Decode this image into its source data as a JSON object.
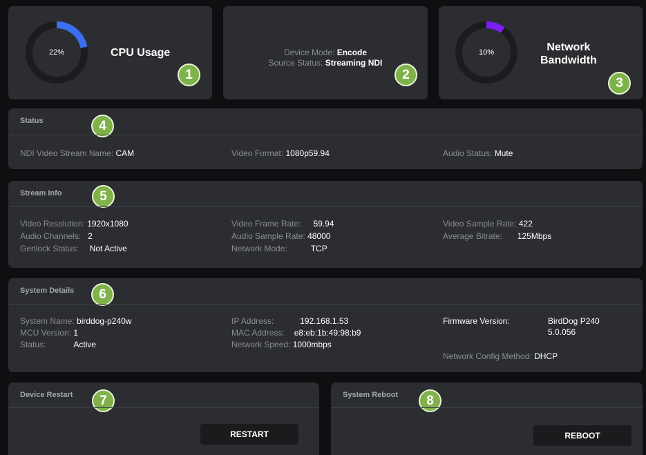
{
  "cpu": {
    "percent_text": "22%",
    "fraction": 0.22,
    "label": "CPU Usage",
    "color": "#3a6ff0"
  },
  "device": {
    "mode_label": "Device Mode:",
    "mode_value": "Encode",
    "source_label": "Source Status:",
    "source_value": "Streaming NDI"
  },
  "network": {
    "percent_text": "10%",
    "fraction": 0.1,
    "label_line1": "Network",
    "label_line2": "Bandwidth",
    "color": "#7a1ff0"
  },
  "badges": [
    "1",
    "2",
    "3",
    "4",
    "5",
    "6",
    "7",
    "8"
  ],
  "status": {
    "title": "Status",
    "ndi_label": "NDI Video Stream Name:",
    "ndi_value": "CAM",
    "format_label": "Video Format:",
    "format_value": "1080p59.94",
    "audio_label": "Audio Status:",
    "audio_value": "Mute"
  },
  "stream_info": {
    "title": "Stream Info",
    "resolution_label": "Video Resolution:",
    "resolution_value": "1920x1080",
    "channels_label": "Audio Channels:",
    "channels_value": "2",
    "genlock_label": "Genlock Status:",
    "genlock_value": "Not Active",
    "framerate_label": "Video Frame Rate:",
    "framerate_value": "59.94",
    "samplerate_label": "Audio Sample Rate:",
    "samplerate_value": "48000",
    "netmode_label": "Network Mode:",
    "netmode_value": "TCP",
    "vsample_label": "Video Sample Rate:",
    "vsample_value": "422",
    "bitrate_label": "Average Bitrate:",
    "bitrate_value": "125Mbps"
  },
  "system": {
    "title": "System Details",
    "name_label": "System Name:",
    "name_value": "birddog-p240w",
    "mcu_label": "MCU Version:",
    "mcu_value": "1",
    "status_label": "Status:",
    "status_value": "Active",
    "ip_label": "IP Address:",
    "ip_value": "192.168.1.53",
    "mac_label": "MAC Address:",
    "mac_value": "e8:eb:1b:49:98:b9",
    "speed_label": "Network Speed:",
    "speed_value": "1000mbps",
    "fw_label": "Firmware Version:",
    "fw_value_line1": "BirdDog P240",
    "fw_value_line2": "5.0.056",
    "netcfg_label": "Network Config Method:",
    "netcfg_value": "DHCP"
  },
  "restart": {
    "title": "Device Restart",
    "button": "RESTART"
  },
  "reboot": {
    "title": "System Reboot",
    "button": "REBOOT"
  }
}
